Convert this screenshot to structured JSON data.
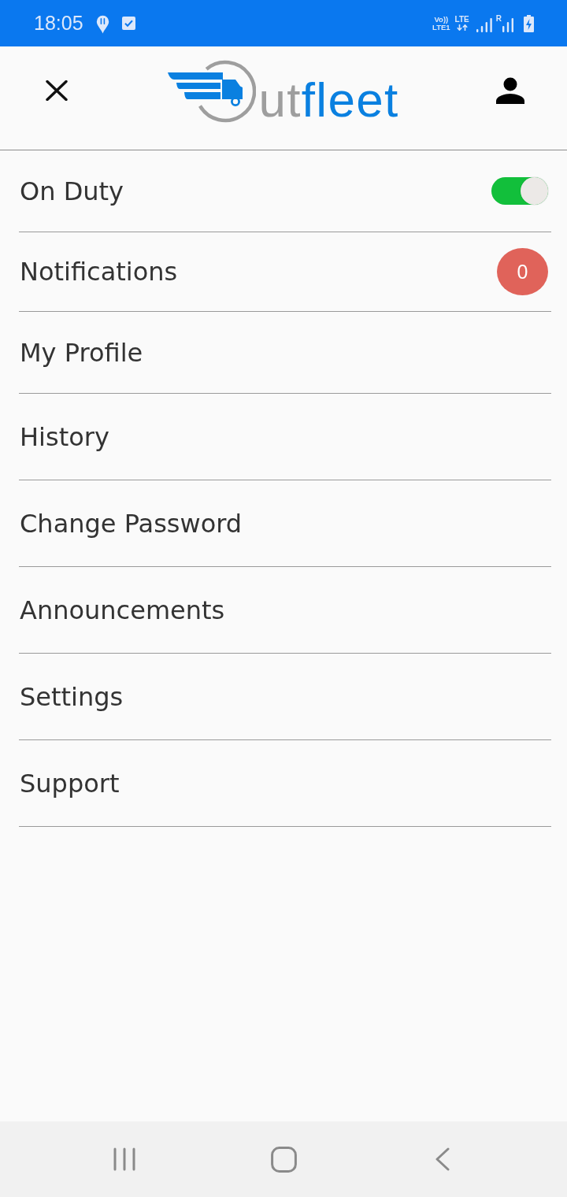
{
  "status_bar": {
    "time": "18:05",
    "volte": [
      "Vo))",
      "LTE1"
    ],
    "data_network": "LTE",
    "roaming": "R"
  },
  "header": {
    "logo": {
      "wordmark": [
        {
          "text": "ut",
          "color": "#9e9e9e"
        },
        {
          "text": "fleet",
          "color": "#0a80e0"
        }
      ]
    }
  },
  "menu": [
    {
      "label": "On Duty",
      "kind": "toggle",
      "on": true
    },
    {
      "label": "Notifications",
      "kind": "badge",
      "badge": "0"
    },
    {
      "label": "My Profile",
      "kind": "link"
    },
    {
      "label": "History",
      "kind": "link"
    },
    {
      "label": "Change Password",
      "kind": "link"
    },
    {
      "label": "Announcements",
      "kind": "link"
    },
    {
      "label": "Settings",
      "kind": "link"
    },
    {
      "label": "Support",
      "kind": "link"
    }
  ]
}
